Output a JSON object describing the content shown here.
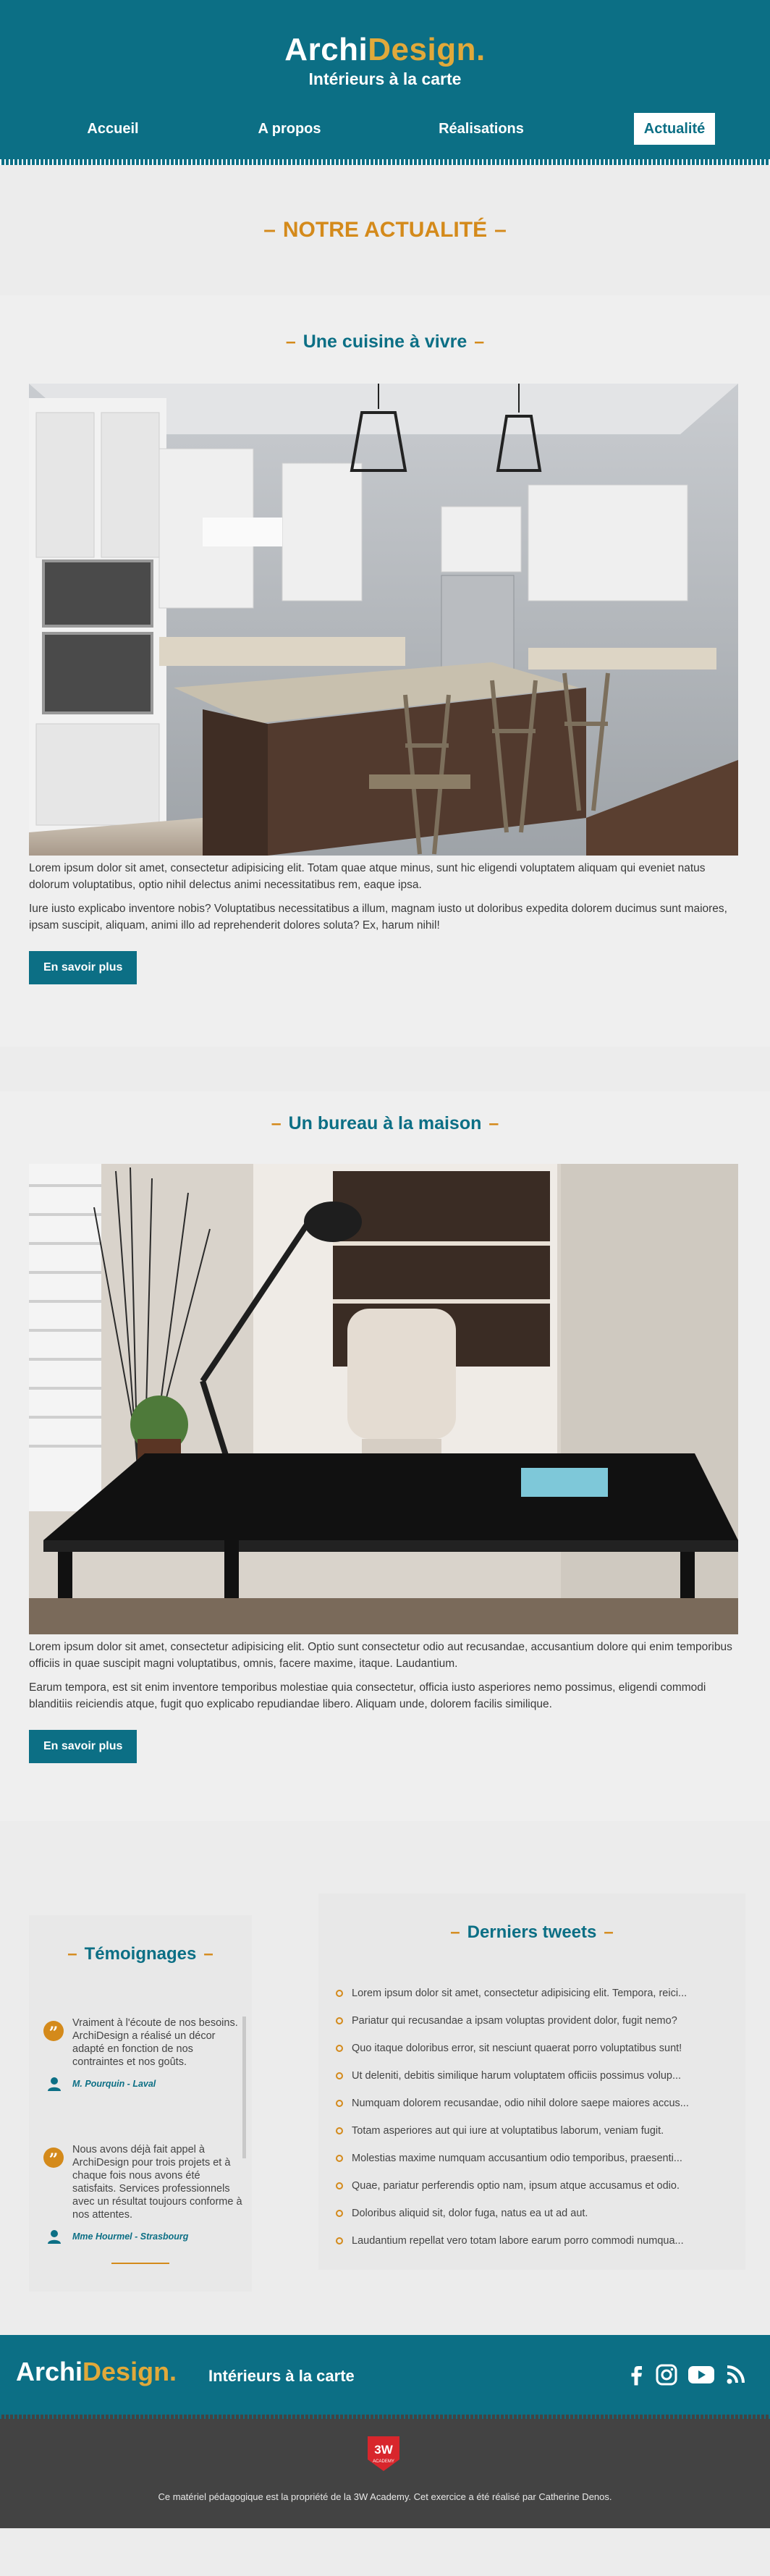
{
  "brand": {
    "name_part1": "Archi",
    "name_part2": "Design.",
    "tagline": "Intérieurs à la carte"
  },
  "nav": [
    {
      "label": "Accueil",
      "active": false
    },
    {
      "label": "A propos",
      "active": false
    },
    {
      "label": "Réalisations",
      "active": false
    },
    {
      "label": "Actualité",
      "active": true
    }
  ],
  "page_title": "NOTRE ACTUALITÉ",
  "articles": [
    {
      "title": "Une cuisine à vivre",
      "image": "kitchen-photo",
      "paragraphs": [
        "Lorem ipsum dolor sit amet, consectetur adipisicing elit. Totam quae atque minus, sunt hic eligendi voluptatem aliquam qui eveniet natus dolorum voluptatibus, optio nihil delectus animi necessitatibus rem, eaque ipsa.",
        "Iure iusto explicabo inventore nobis? Voluptatibus necessitatibus a illum, magnam iusto ut doloribus expedita dolorem ducimus sunt maiores, ipsam suscipit, aliquam, animi illo ad reprehenderit dolores soluta? Ex, harum nihil!"
      ],
      "button": "En savoir plus"
    },
    {
      "title": "Un bureau à la maison",
      "image": "home-office-photo",
      "paragraphs": [
        "Lorem ipsum dolor sit amet, consectetur adipisicing elit. Optio sunt consectetur odio aut recusandae, accusantium dolore qui enim temporibus officiis in quae suscipit magni voluptatibus, omnis, facere maxime, itaque. Laudantium.",
        "Earum tempora, est sit enim inventore temporibus molestiae quia consectetur, officia iusto asperiores nemo possimus, eligendi commodi blanditiis reiciendis atque, fugit quo explicabo repudiandae libero. Aliquam unde, dolorem facilis similique."
      ],
      "button": "En savoir plus"
    }
  ],
  "testimonials": {
    "title": "Témoignages",
    "items": [
      {
        "text": "Vraiment à l'écoute de nos besoins. ArchiDesign a réalisé un décor adapté en fonction de nos contraintes et nos goûts.",
        "author": "M. Pourquin - Laval"
      },
      {
        "text": "Nous avons déjà fait appel à ArchiDesign pour trois projets et à chaque fois nous avons été satisfaits. Services professionnels avec un résultat toujours conforme à nos attentes.",
        "author": "Mme Hourmel - Strasbourg"
      }
    ]
  },
  "tweets": {
    "title": "Derniers tweets",
    "items": [
      "Lorem ipsum dolor sit amet, consectetur adipisicing elit. Tempora, reici...",
      "Pariatur qui recusandae a ipsam voluptas provident dolor, fugit nemo?",
      "Quo itaque doloribus error, sit nesciunt quaerat porro voluptatibus sunt!",
      "Ut deleniti, debitis similique harum voluptatem officiis possimus volup...",
      "Numquam dolorem recusandae, odio nihil dolore saepe maiores accus...",
      "Totam asperiores aut qui iure at voluptatibus laborum, veniam fugit.",
      "Molestias maxime numquam accusantium odio temporibus, praesenti...",
      "Quae, pariatur perferendis optio nam, ipsum atque accusamus et odio.",
      "Doloribus aliquid sit, dolor fuga, natus ea ut ad aut.",
      "Laudantium repellat vero totam labore earum porro commodi numqua..."
    ]
  },
  "footer": {
    "name_part1": "Archi",
    "name_part2": "Design.",
    "tagline": "Intérieurs à la carte",
    "social": [
      "facebook-icon",
      "instagram-icon",
      "youtube-icon",
      "rss-icon"
    ],
    "badge_text": "3W",
    "badge_subtext": "ACADEMY",
    "note": "Ce matériel pédagogique est la propriété de la 3W Academy. Cet exercice a été réalisé par Catherine Denos."
  },
  "colors": {
    "primary": "#0c6f85",
    "accent": "#d48a1b",
    "background": "#ececec"
  }
}
